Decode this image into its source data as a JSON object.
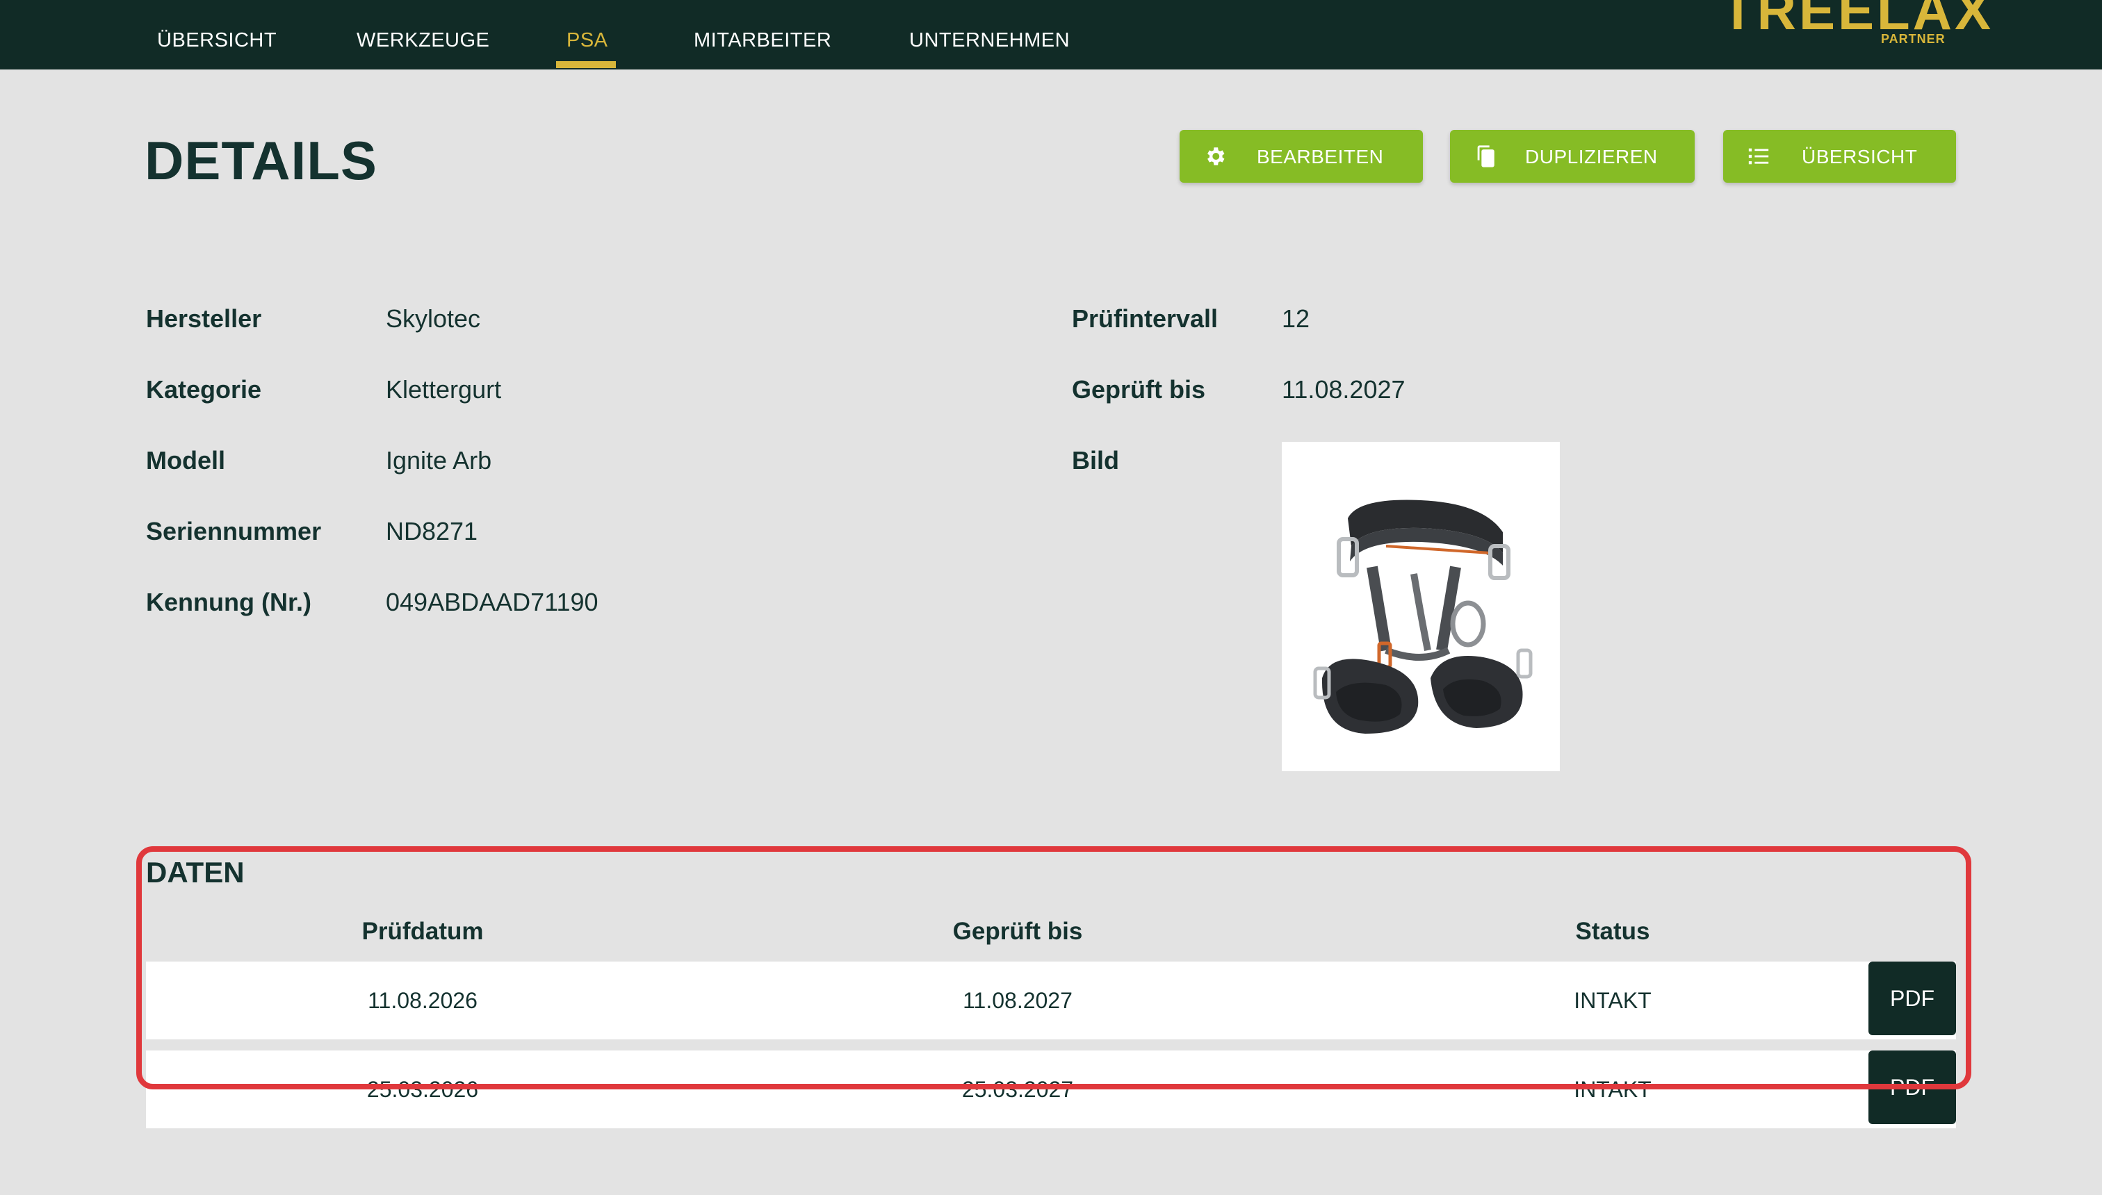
{
  "nav": {
    "items": [
      {
        "label": "ÜBERSICHT"
      },
      {
        "label": "WERKZEUGE"
      },
      {
        "label": "PSA"
      },
      {
        "label": "MITARBEITER"
      },
      {
        "label": "UNTERNEHMEN"
      }
    ],
    "active": "PSA"
  },
  "logo": {
    "brand": "TREELAX",
    "sub": "PARTNER"
  },
  "page": {
    "title": "DETAILS"
  },
  "actions": {
    "edit_label": "BEARBEITEN",
    "duplicate_label": "DUPLIZIEREN",
    "overview_label": "ÜBERSICHT",
    "edit_icon": "gear-icon",
    "duplicate_icon": "copy-icon",
    "overview_icon": "list-icon"
  },
  "details": {
    "left": [
      {
        "label": "Hersteller",
        "value": "Skylotec"
      },
      {
        "label": "Kategorie",
        "value": "Klettergurt"
      },
      {
        "label": "Modell",
        "value": "Ignite Arb"
      },
      {
        "label": "Seriennummer",
        "value": "ND8271"
      },
      {
        "label": "Kennung (Nr.)",
        "value": "049ABDAAD71190"
      }
    ],
    "right": [
      {
        "label": "Prüfintervall",
        "value": "12"
      },
      {
        "label": "Geprüft bis",
        "value": "11.08.2027"
      },
      {
        "label": "Bild",
        "value": ""
      }
    ]
  },
  "data_section": {
    "title": "DATEN",
    "columns": [
      "Prüfdatum",
      "Geprüft bis",
      "Status"
    ],
    "rows": [
      {
        "pruefdatum": "11.08.2026",
        "geprueft_bis": "11.08.2027",
        "status": "INTAKT",
        "pdf_label": "PDF"
      },
      {
        "pruefdatum": "25.03.2026",
        "geprueft_bis": "25.03.2027",
        "status": "INTAKT",
        "pdf_label": "PDF"
      }
    ]
  },
  "colors": {
    "header_bg": "#112b26",
    "accent_gold": "#d8b63a",
    "button_green": "#86bc25",
    "highlight_red": "#e0383c",
    "page_bg": "#e3e3e3"
  }
}
